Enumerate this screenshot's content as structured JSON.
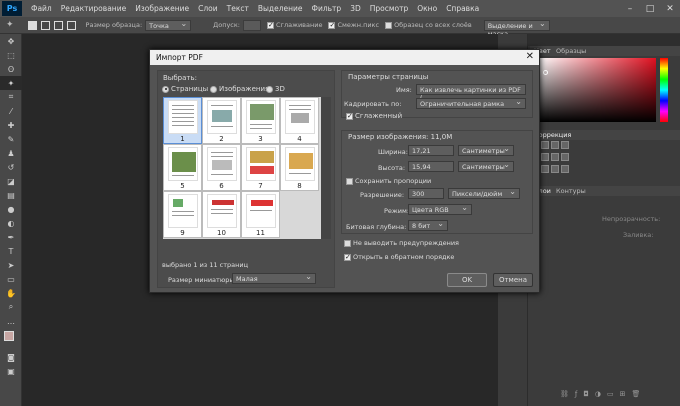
{
  "app": {
    "logo": "Ps"
  },
  "menu": [
    "Файл",
    "Редактирование",
    "Изображение",
    "Слои",
    "Текст",
    "Выделение",
    "Фильтр",
    "3D",
    "Просмотр",
    "Окно",
    "Справка"
  ],
  "window_controls": {
    "minimize": "–",
    "maximize": "□",
    "close": "✕"
  },
  "options_bar": {
    "size_label": "Размер образца:",
    "size_value": "Точка",
    "tolerance_label": "Допуск:",
    "antialias_label": "Сглаживание",
    "contiguous_label": "Смежн.пикс",
    "all_layers_label": "Образец со всех слоёв",
    "refine_label": "Выделение и маска..."
  },
  "right_panel": {
    "tab1": "Цвет",
    "tab2": "Образцы",
    "adjust_tab": "Коррекция",
    "layers_tab": "Слои",
    "paths_tab": "Контуры",
    "opacity_label": "Непрозрачность:",
    "fill_label": "Заливка:"
  },
  "dialog": {
    "title": "Импорт PDF",
    "close": "✕",
    "select_label": "Выбрать:",
    "radio_pages": "Страницы",
    "radio_images": "Изображения",
    "radio_3d": "3D",
    "pages": [
      "1",
      "2",
      "3",
      "4",
      "5",
      "6",
      "7",
      "8",
      "9",
      "10",
      "11"
    ],
    "selected_count": "выбрано 1 из 11 страниц",
    "thumb_size_label": "Размер миниатюры:",
    "thumb_size_value": "Малая",
    "page_options_title": "Параметры страницы",
    "name_label": "Имя:",
    "name_value": "Как извлечь картинки из PDF (",
    "crop_label": "Кадрировать по:",
    "crop_value": "Ограничительная рамка",
    "antialiased_label": "Сглаженный",
    "image_size_title": "Размер изображения: 11,0M",
    "width_label": "Ширина:",
    "width_value": "17,21",
    "width_unit": "Сантиметры",
    "height_label": "Высота:",
    "height_value": "15,94",
    "height_unit": "Сантиметры",
    "constrain_label": "Сохранить пропорции",
    "resolution_label": "Разрешение:",
    "resolution_value": "300",
    "resolution_unit": "Пиксели/дюйм",
    "mode_label": "Режим:",
    "mode_value": "Цвета RGB",
    "depth_label": "Битовая глубина:",
    "depth_value": "8 бит",
    "suppress_label": "Не выводить предупреждения",
    "reverse_label": "Открыть в обратном порядке",
    "ok": "OK",
    "cancel": "Отмена"
  },
  "colors": {
    "accent": "#31a8ff",
    "chrome": "#535353",
    "canvas": "#282828"
  }
}
